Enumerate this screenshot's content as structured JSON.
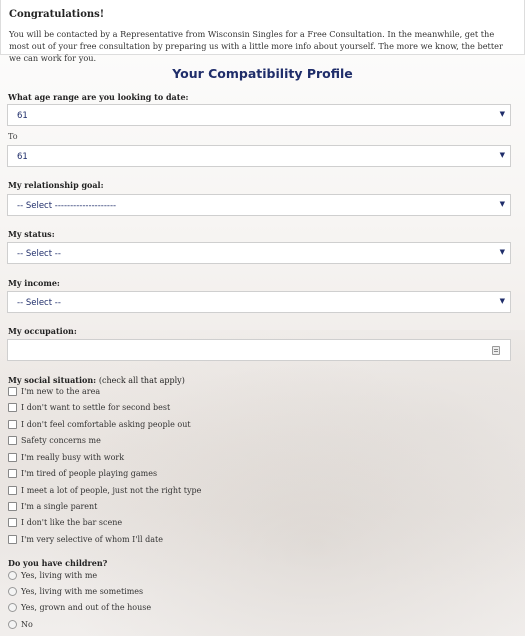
{
  "header": {
    "title": "Congratulations!",
    "message": "You will be contacted by a Representative from Wisconsin Singles for a Free Consultation. In the meanwhile, get the most out of your free consultation by preparing us with a little more info about yourself. The more we know, the better we can work for you."
  },
  "profile": {
    "title": "Your Compatibility Profile",
    "age": {
      "label": "What age range are you looking to date:",
      "from_value": "61",
      "to_label": "To",
      "to_value": "61"
    },
    "goal": {
      "label": "My relationship goal:",
      "value": "-- Select --------------------"
    },
    "status": {
      "label": "My status:",
      "value": "-- Select --"
    },
    "income": {
      "label": "My income:",
      "value": "-- Select --"
    },
    "occupation": {
      "label": "My occupation:",
      "value": ""
    },
    "social": {
      "label": "My social situation:",
      "hint": "(check all that apply)",
      "options": [
        "I'm new to the area",
        "I don't want to settle for second best",
        "I don't feel comfortable asking people out",
        "Safety concerns me",
        "I'm really busy with work",
        "I'm tired of people playing games",
        "I meet a lot of people, just not the right type",
        "I'm a single parent",
        "I don't like the bar scene",
        "I'm very selective of whom I'll date"
      ]
    },
    "children": {
      "label": "Do you have children?",
      "options": [
        "Yes, living with me",
        "Yes, living with me sometimes",
        "Yes, grown and out of the house",
        "No"
      ]
    }
  },
  "icons": {
    "dropdown": "dropdown-arrow-icon",
    "field": "form-field-icon"
  },
  "colors": {
    "title": "#1f2d6a",
    "select_text": "#1f2d6a",
    "border": "#cfcfcf"
  }
}
